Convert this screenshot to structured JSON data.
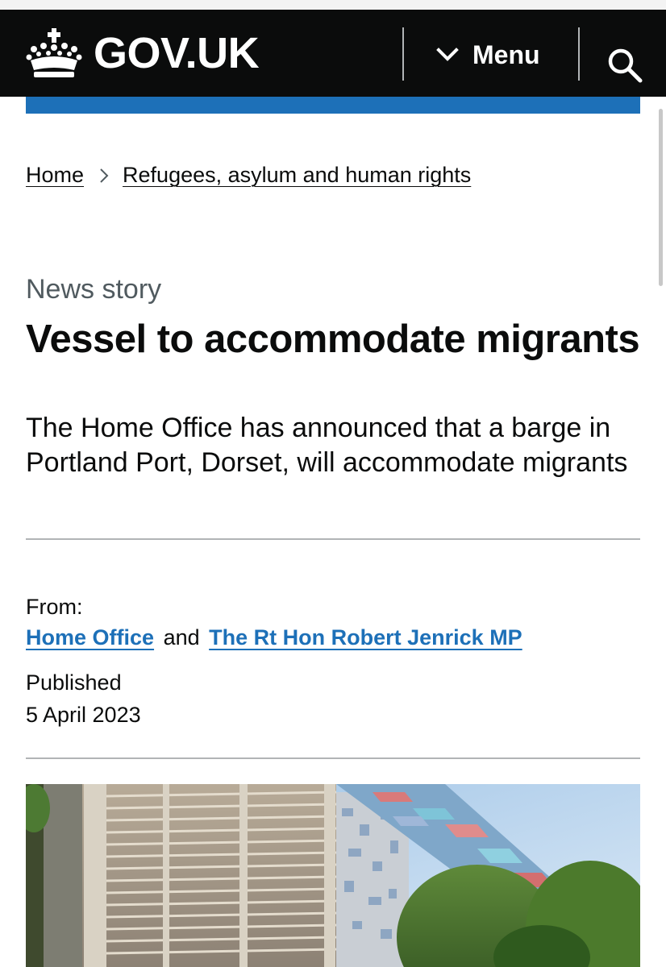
{
  "header": {
    "logo_text": "GOV.UK",
    "menu_label": "Menu",
    "crown_icon": "crown-icon",
    "menu_icon": "chevron-down-icon",
    "search_icon": "search-icon"
  },
  "colors": {
    "header_bg": "#0b0c0c",
    "accent_blue": "#1d70b8",
    "link": "#1d70b8",
    "secondary_text": "#505a5f",
    "rule": "#b1b4b6"
  },
  "breadcrumb": {
    "items": [
      "Home",
      "Refugees, asylum and human rights"
    ],
    "separator_icon": "chevron-right-icon"
  },
  "article": {
    "caption": "News story",
    "title": "Vessel to accommodate migrants",
    "summary": "The Home Office has announced that a barge in Portland Port, Dorset, will accommodate migrants"
  },
  "metadata": {
    "from_label": "From:",
    "organisations": [
      "Home Office",
      "The Rt Hon Robert Jenrick MP"
    ],
    "conjunction": "and",
    "published_label": "Published",
    "published_date": "5 April 2023"
  }
}
